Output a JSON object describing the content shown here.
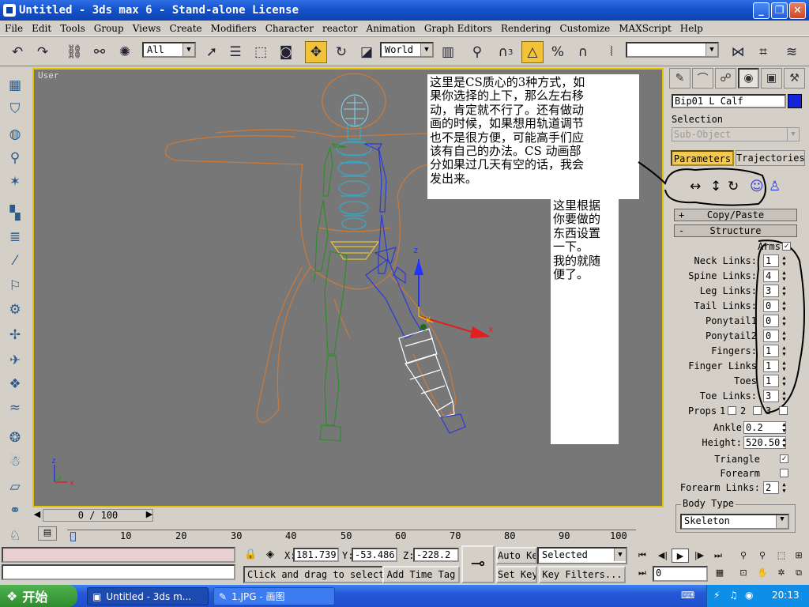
{
  "title_bar": {
    "text": "Untitled - 3ds max 6 - Stand-alone License"
  },
  "menu": [
    {
      "label": "File"
    },
    {
      "label": "Edit"
    },
    {
      "label": "Tools"
    },
    {
      "label": "Group"
    },
    {
      "label": "Views"
    },
    {
      "label": "Create"
    },
    {
      "label": "Modifiers"
    },
    {
      "label": "Character"
    },
    {
      "label": "reactor"
    },
    {
      "label": "Animation"
    },
    {
      "label": "Graph Editors"
    },
    {
      "label": "Rendering"
    },
    {
      "label": "Customize"
    },
    {
      "label": "MAXScript"
    },
    {
      "label": "Help"
    }
  ],
  "toolbar": {
    "selection_filter": "All",
    "reference_coord": "World",
    "named_selection": "",
    "snap_angle_label": "3",
    "icons": [
      "undo-icon",
      "redo-icon",
      "link-icon",
      "unlink-icon",
      "bind-space-warp-icon",
      "select-object-icon",
      "select-by-name-icon",
      "rect-selection-icon",
      "window-crossing-icon",
      "move-icon",
      "rotate-icon",
      "scale-icon",
      "mirror-pivot-icon",
      "manipulate-icon",
      "snap-toggle-icon",
      "angle-snap-icon",
      "percent-snap-icon",
      "spinner-snap-icon",
      "abc-named-sel-icon",
      "mirror-icon",
      "align-icon",
      "layer-icon"
    ]
  },
  "viewport": {
    "label": "User",
    "note_main": "这里是CS质心的3种方式，如\n果你选择的上下，那么左右移\n动，肯定就不行了。还有做动\n画的时候，如果想用轨道调节\n也不是很方便，可能高手们应\n该有自己的办法。CS 动画部\n分如果过几天有空的话，我会\n发出来。",
    "note_side": "这里根据\n你要做的\n东西设置\n一下。\n我的就随\n便了。",
    "axis_labels": {
      "x": "x",
      "y": "y",
      "z": "z"
    }
  },
  "command_panel": {
    "object_name": "Bip01 L Calf",
    "object_color": "#1424d8",
    "selection_label": "Selection",
    "subobject_placeholder": "Sub-Object",
    "tabs": [
      {
        "label": "Parameters"
      },
      {
        "label": "Trajectories"
      }
    ],
    "copy_paste": {
      "sign": "+",
      "label": "Copy/Paste"
    },
    "structure": {
      "sign": "-",
      "label": "Structure"
    },
    "arms_label": "Arms",
    "params": [
      {
        "label": "Neck Links:",
        "value": "1"
      },
      {
        "label": "Spine Links:",
        "value": "4"
      },
      {
        "label": "Leg Links:",
        "value": "3"
      },
      {
        "label": "Tail Links:",
        "value": "0"
      },
      {
        "label": "Ponytail1",
        "value": "0"
      },
      {
        "label": "Ponytail2",
        "value": "0"
      },
      {
        "label": "Fingers:",
        "value": "1"
      },
      {
        "label": "Finger Links",
        "value": "1"
      },
      {
        "label": "Toes",
        "value": "1"
      },
      {
        "label": "Toe Links:",
        "value": "3"
      }
    ],
    "props_label": "Props",
    "props_options": [
      "1",
      "2",
      "3"
    ],
    "ankle": {
      "label": "Ankle",
      "value": "0.2"
    },
    "height": {
      "label": "Height:",
      "value": "520.50"
    },
    "triangle": {
      "label": "Triangle",
      "checked": true
    },
    "forearm": {
      "label": "Forearm",
      "checked": false
    },
    "forearm_links": {
      "label": "Forearm Links:",
      "value": "2"
    },
    "body_type": {
      "caption": "Body Type",
      "value": "Skeleton"
    }
  },
  "timeline": {
    "slider_text": "0 / 100",
    "ticks": [
      "0",
      "10",
      "20",
      "30",
      "40",
      "50",
      "60",
      "70",
      "80",
      "90",
      "100"
    ]
  },
  "status": {
    "coords": {
      "x_label": "X:",
      "x": "181.739",
      "y_label": "Y:",
      "y": "-53.486",
      "z_label": "Z:",
      "z": "-228.2"
    },
    "hint": "Click and drag to select",
    "add_time_tag": "Add Time Tag",
    "auto_key": "Auto Key",
    "set_key": "Set Key",
    "key_mode": "Selected",
    "key_filters": "Key Filters...",
    "frame": "0"
  },
  "taskbar": {
    "start": "开始",
    "items": [
      {
        "label": "Untitled - 3ds m..."
      },
      {
        "label": "1.JPG - 画图"
      }
    ],
    "clock": "20:13"
  }
}
